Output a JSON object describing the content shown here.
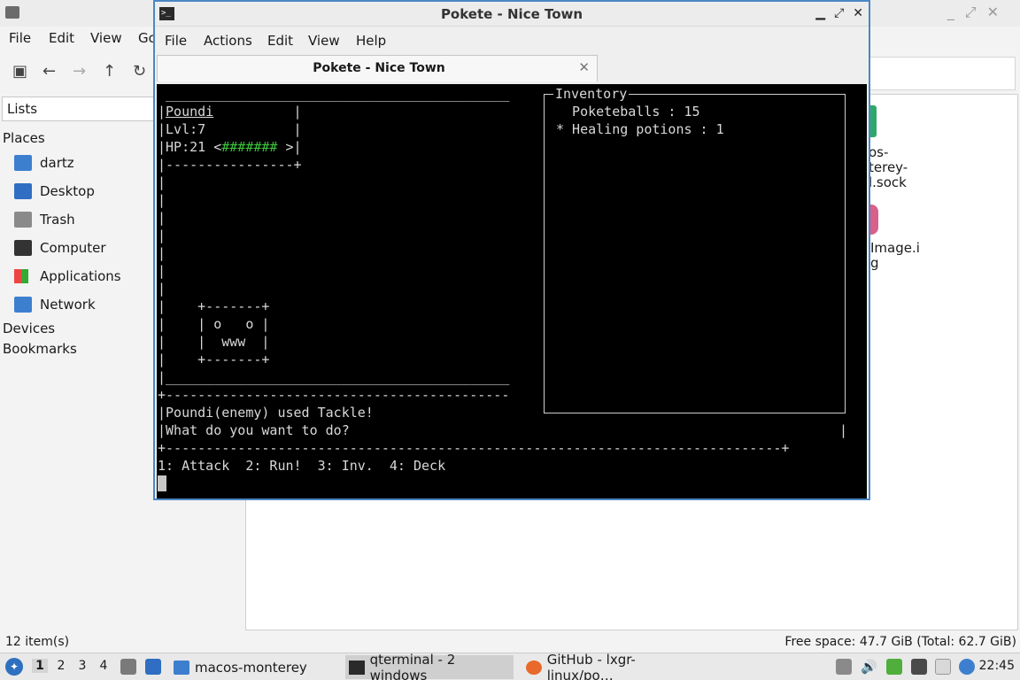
{
  "file_manager": {
    "menu": [
      "File",
      "Edit",
      "View",
      "Go"
    ],
    "sidebar": {
      "selector": "Lists",
      "places_heading": "Places",
      "places": [
        "dartz",
        "Desktop",
        "Trash",
        "Computer",
        "Applications",
        "Network"
      ],
      "devices_heading": "Devices",
      "bookmarks_heading": "Bookmarks"
    },
    "icons": [
      {
        "lines": [
          "os-",
          "terey-",
          "l.sock"
        ]
      },
      {
        "lines": [
          "Image.i",
          "g"
        ]
      }
    ],
    "status_left": "12 item(s)",
    "status_right": "Free space: 47.7 GiB (Total: 62.7 GiB)"
  },
  "terminal": {
    "window_title": "Pokete - Nice Town",
    "menu": [
      "File",
      "Actions",
      "Edit",
      "View",
      "Help"
    ],
    "tab_title": "Pokete - Nice Town",
    "screen": {
      "top_border": " ___________________________________________",
      "poke_name": "Poundi",
      "level": "|Lvl:7           |",
      "hp_prefix": "|HP:21 <",
      "hp_bar": "#######",
      "hp_suffix": " >|",
      "sep": "|----------------+",
      "side": "|",
      "art1": "|    +-------+",
      "art2": "|    | o   o |",
      "art3": "|    |  www  |",
      "art4": "|    +-------+",
      "bottom": "|___________________________________________",
      "divider": "+-------------------------------------------",
      "message1": "|Poundi(enemy) used Tackle!",
      "message2": "|What do you want to do?",
      "message_right": "|",
      "divider2": "+-----------------------------------------------------------------------------+",
      "options": "1: Attack  2: Run!  3: Inv.  4: Deck",
      "inventory": {
        "title": "Inventory",
        "items": [
          "  Poketeballs : 15",
          "* Healing potions : 1"
        ]
      }
    }
  },
  "taskbar": {
    "workspaces": [
      "1",
      "2",
      "3",
      "4"
    ],
    "tasks": [
      "macos-monterey",
      "qterminal - 2 windows",
      "GitHub - lxgr-linux/po…"
    ],
    "clock": "22:45"
  }
}
